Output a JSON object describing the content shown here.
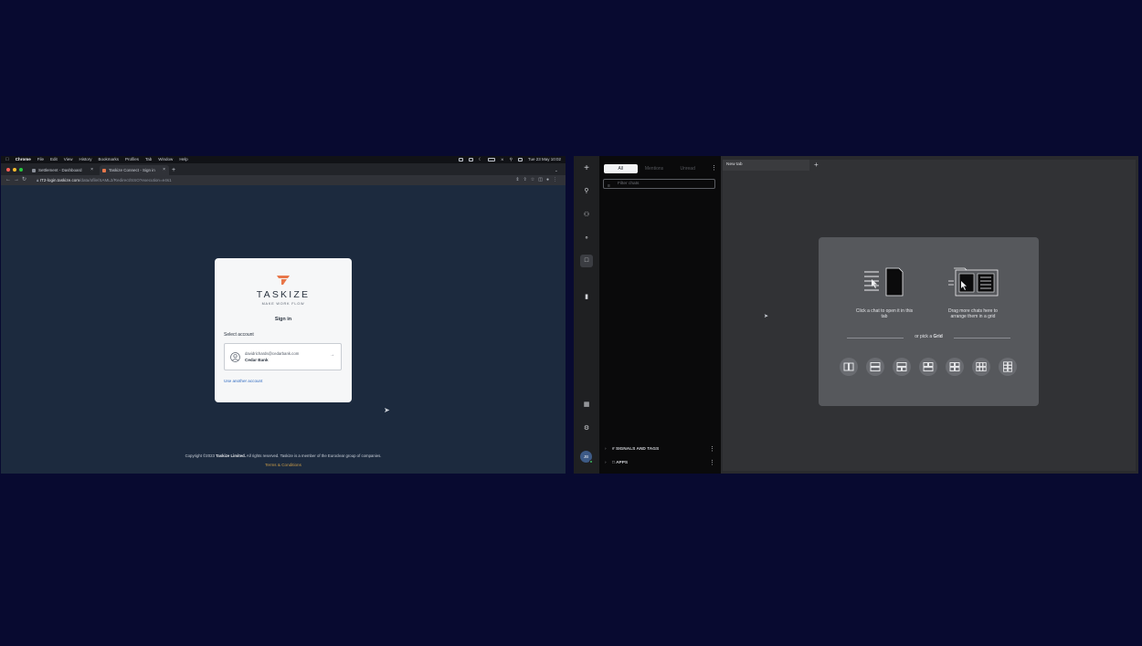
{
  "left_window": {
    "menubar": {
      "apple": "",
      "app": "Chrome",
      "items": [
        "File",
        "Edit",
        "View",
        "History",
        "Bookmarks",
        "Profiles",
        "Tab",
        "Window",
        "Help"
      ],
      "clock": "Tue 23 May  10:02"
    },
    "tabs": [
      {
        "label": "Settlement - Dashboard",
        "active": false
      },
      {
        "label": "Taskize Connect - Sign in",
        "active": true
      }
    ],
    "url": {
      "host": "IT2-login.taskize.com",
      "path": "/data/ofile/SAML2/Redirect/SSO?execution=e4s1"
    },
    "login": {
      "brand": "TASKIZE",
      "tagline": "MAKE WORK FLOW",
      "heading": "Sign in",
      "select_label": "Select account",
      "account_email": "davidrichards@cedarbank.com",
      "account_org": "Cedar Bank",
      "another": "Use another account"
    },
    "footer": {
      "copyright_pre": "Copyright ©2023 ",
      "copyright_company": "Taskize Limited.",
      "copyright_post": " All rights reserved. Taskize is a member of the Euroclear group of companies.",
      "terms": "Terms & Conditions"
    },
    "colors": {
      "accent": "#e8774a",
      "link": "#2f6ac0",
      "terms": "#c79a48"
    }
  },
  "right_window": {
    "rail_icons": [
      "plus-icon",
      "search-icon",
      "contacts-icon",
      "bell-icon",
      "chat-icon",
      "bookmark-icon",
      "qr-icon",
      "settings-icon"
    ],
    "user_initials": "JB",
    "filters": [
      "All",
      "Mentions",
      "Unread"
    ],
    "filter_placeholder": "Filter chats",
    "sections": [
      "SIGNALS AND TAGS",
      "APPS"
    ],
    "tab_label": "New tab",
    "tab_plus": "+",
    "hint_left": [
      "Click a chat to open it in this",
      "tab"
    ],
    "hint_right": [
      "Drag more chats here to",
      "arrange them in a grid"
    ],
    "pick_pre": "or pick a ",
    "pick_bold": "Grid"
  }
}
